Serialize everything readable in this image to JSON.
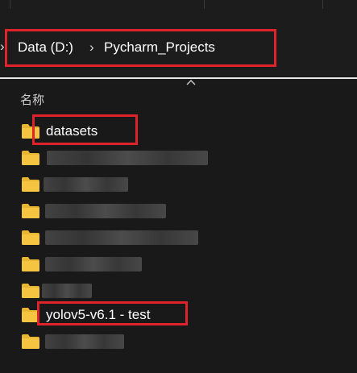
{
  "address_bar": {
    "lead_chevron": "›",
    "breadcrumbs": [
      "Data (D:)",
      "Pycharm_Projects"
    ],
    "separator": "›"
  },
  "file_list": {
    "column_header": "名称",
    "items": [
      {
        "name": "datasets",
        "obscured": false
      },
      {
        "name": "",
        "obscured": true
      },
      {
        "name": "",
        "obscured": true
      },
      {
        "name": "",
        "obscured": true
      },
      {
        "name": "",
        "obscured": true
      },
      {
        "name": "",
        "obscured": true
      },
      {
        "name": "",
        "obscured": true
      },
      {
        "name": "yolov5-v6.1 - test",
        "obscured": false
      },
      {
        "name": "",
        "obscured": true
      }
    ]
  },
  "colors": {
    "highlight_box": "#e0232b",
    "folder": "#f5c542",
    "background": "#191919"
  },
  "icons": [
    "chevron-right-icon",
    "sort-up-chevron-icon",
    "folder-icon"
  ]
}
